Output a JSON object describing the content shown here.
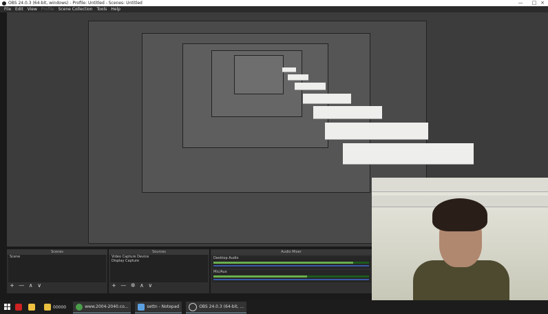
{
  "window": {
    "title": "OBS 24.0.3 (64-bit, windows) - Profile: Untitled - Scenes: Untitled",
    "controls": [
      "—",
      "□",
      "×"
    ]
  },
  "menubar": {
    "items": [
      {
        "label": "File",
        "disabled": false
      },
      {
        "label": "Edit",
        "disabled": false
      },
      {
        "label": "View",
        "disabled": false
      },
      {
        "label": "Profile",
        "disabled": true
      },
      {
        "label": "Scene Collection",
        "disabled": false
      },
      {
        "label": "Tools",
        "disabled": false
      },
      {
        "label": "Help",
        "disabled": false
      }
    ]
  },
  "scenes": {
    "title": "Scenes",
    "items": [
      "Scene"
    ],
    "tools": "+ — ∧ ∨"
  },
  "sources": {
    "title": "Sources",
    "items": [
      "Video Capture Device",
      "Display Capture"
    ],
    "tools": "+ — ✲ ∧ ∨"
  },
  "mixer": {
    "title": "Audio Mixer",
    "tracks": [
      {
        "name": "Desktop Audio",
        "level": 0.9
      },
      {
        "name": "Mic/Aux",
        "level": 0.6
      }
    ]
  },
  "taskbar": {
    "items": [
      {
        "name": "start-button",
        "label": "",
        "color": "#ffffff"
      },
      {
        "name": "app-red",
        "label": "",
        "color": "#cc2222"
      },
      {
        "name": "app-bolt",
        "label": "",
        "color": "#f0c040"
      },
      {
        "name": "folder",
        "label": "00000",
        "color": "#e8c040"
      },
      {
        "name": "chrome",
        "label": "www.2004-2040.co...",
        "color": "#4a9d4a"
      },
      {
        "name": "notepad",
        "label": "settn - Notepad",
        "color": "#5aa0e0"
      },
      {
        "name": "obs",
        "label": "OBS 24.0.3 (64-bit, ...",
        "color": "#333333"
      }
    ]
  },
  "colors": {
    "meter_green": "#6ab04c",
    "slider_blue": "#3a5aa8",
    "panel_bg": "#2f2f2f"
  }
}
